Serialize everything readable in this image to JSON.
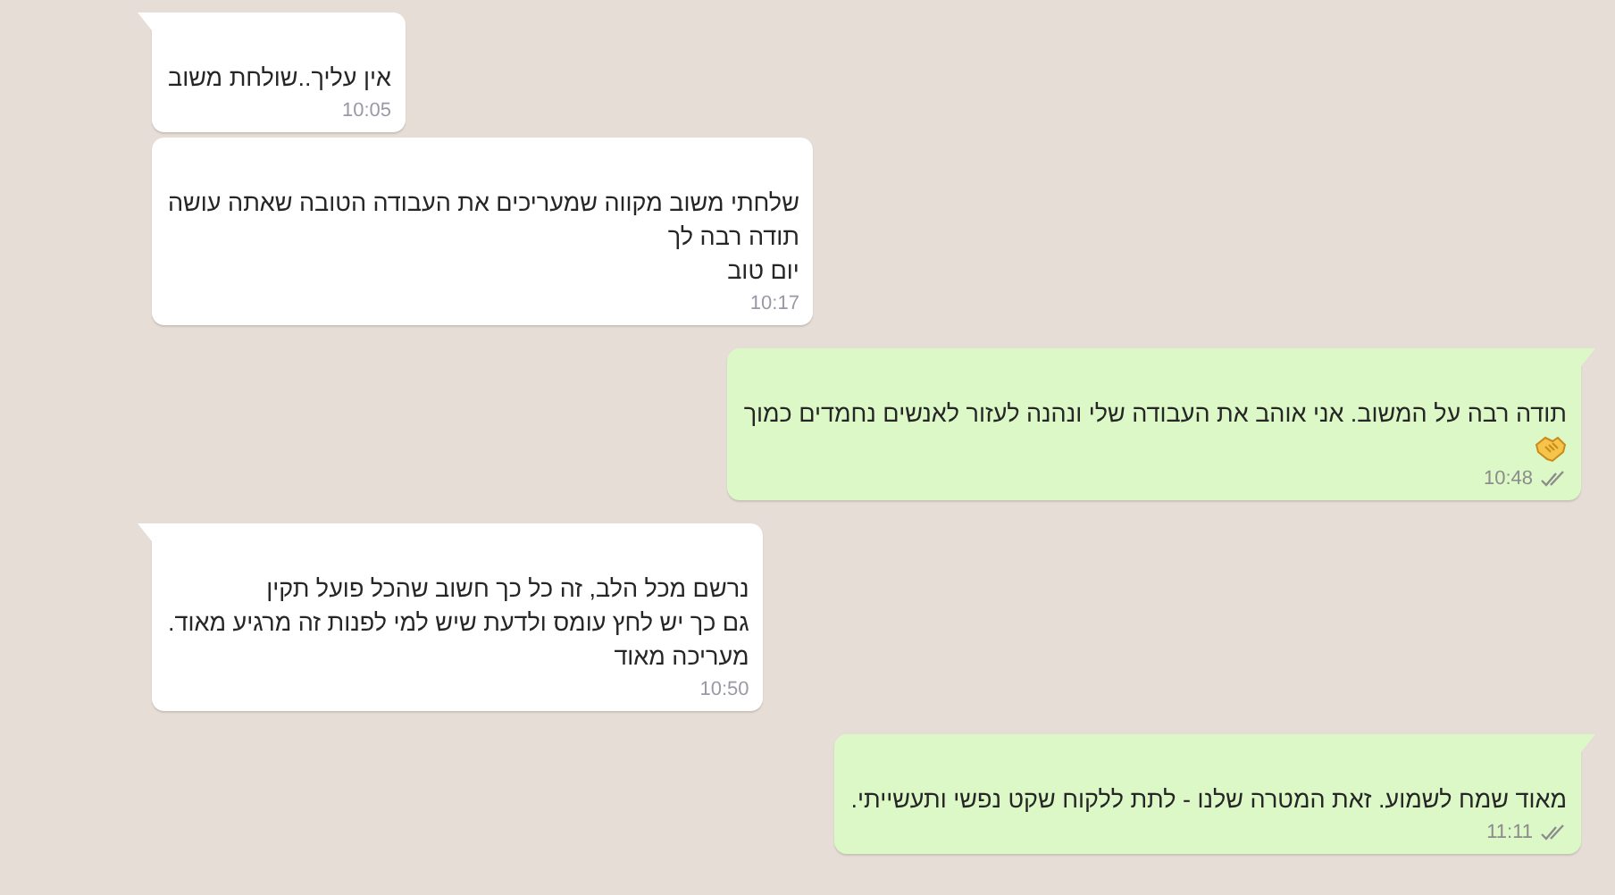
{
  "messages": [
    {
      "kind": "incoming",
      "tail": true,
      "text": "אין עליך..שולחת משוב",
      "time": "10:05"
    },
    {
      "kind": "incoming",
      "tail": false,
      "text": "שלחתי משוב מקווה שמעריכים את העבודה הטובה שאתה עושה\nתודה רבה לך\nיום טוב",
      "time": "10:17"
    },
    {
      "kind": "outgoing",
      "tail": true,
      "text": "תודה רבה על המשוב. אני אוהב את העבודה שלי ונהנה לעזור לאנשים נחמדים כמוך",
      "emoji": true,
      "time": "10:48",
      "delivered": true
    },
    {
      "kind": "incoming",
      "tail": true,
      "text": "נרשם מכל הלב, זה כל כך חשוב שהכל פועל תקין\nגם כך יש לחץ עומס ולדעת שיש למי לפנות זה מרגיע מאוד.\nמעריכה מאוד",
      "time": "10:50"
    },
    {
      "kind": "outgoing",
      "tail": true,
      "text": "מאוד שמח לשמוע. זאת המטרה שלנו - לתת ללקוח שקט נפשי ותעשייתי.",
      "time": "11:11",
      "delivered": true
    }
  ]
}
